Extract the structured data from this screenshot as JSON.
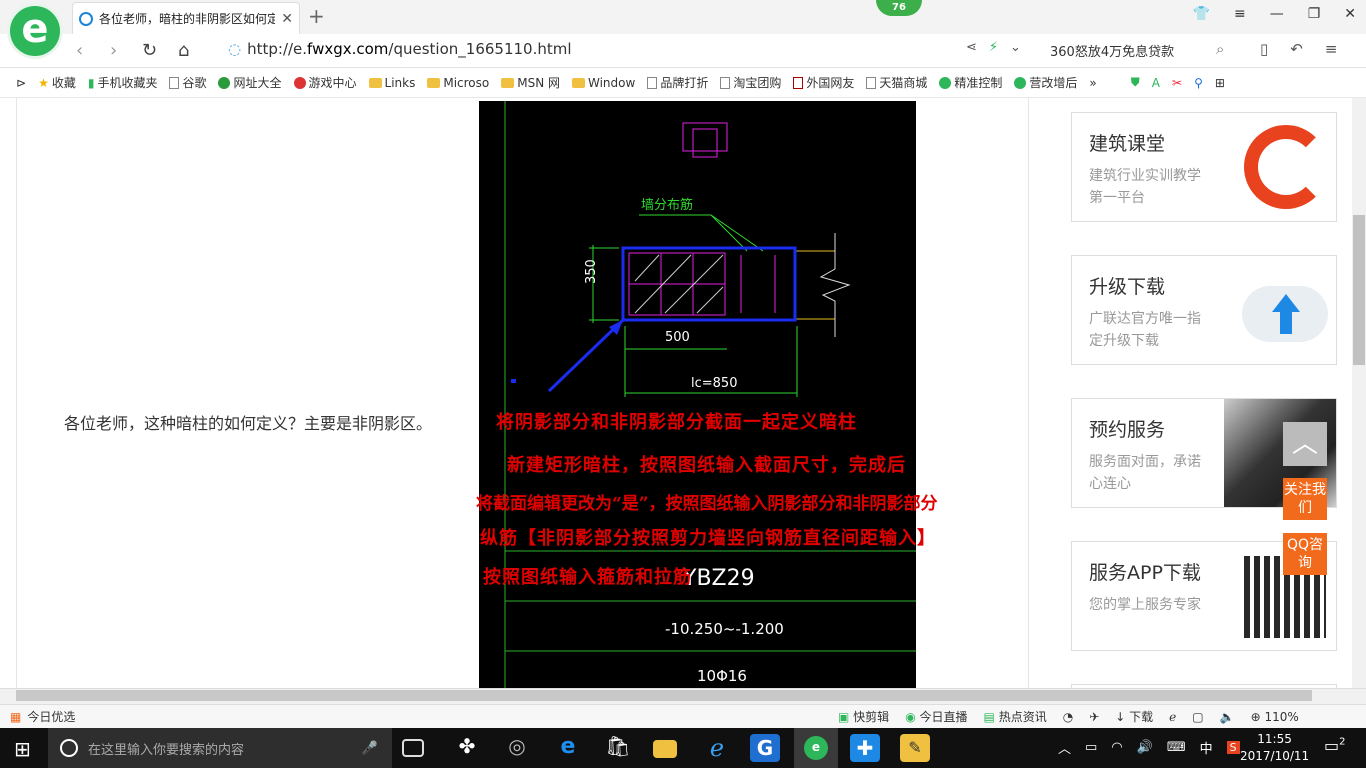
{
  "browser": {
    "tab_title": "各位老师，暗柱的非阴影区如何定",
    "badge": "76",
    "url_prefix": "http://e.",
    "url_domain": "fwxgx.com",
    "url_path": "/question_1665110.html",
    "ad_text": "360怒放4万免息贷款"
  },
  "bookmarks": [
    {
      "label": "收藏",
      "icon": "star-icon"
    },
    {
      "label": "手机收藏夹",
      "icon": "phone-icon"
    },
    {
      "label": "谷歌",
      "icon": "page-icon"
    },
    {
      "label": "网址大全",
      "icon": "globe-icon"
    },
    {
      "label": "游戏中心",
      "icon": "game-icon"
    },
    {
      "label": "Links",
      "icon": "folder-icon"
    },
    {
      "label": "Microso",
      "icon": "folder-icon"
    },
    {
      "label": "MSN 网",
      "icon": "folder-icon"
    },
    {
      "label": "Window",
      "icon": "folder-icon"
    },
    {
      "label": "品牌打折",
      "icon": "page-icon"
    },
    {
      "label": "淘宝团购",
      "icon": "page-icon"
    },
    {
      "label": "外国网友",
      "icon": "page-icon"
    },
    {
      "label": "天猫商城",
      "icon": "page-icon"
    },
    {
      "label": "精准控制",
      "icon": "chat-icon"
    },
    {
      "label": "营改增后",
      "icon": "chat-icon"
    }
  ],
  "question": "各位老师，这种暗柱的如何定义？主要是非阴影区。",
  "cad": {
    "label_wall": "墙分布筋",
    "dim_350": "350",
    "dim_500": "500",
    "dim_lc": "lc=850",
    "table_name": "YBZ29",
    "table_elev": "-10.250~-1.200",
    "table_rebar": "10Φ16"
  },
  "answer": [
    "将阴影部分和非阴影部分截面一起定义暗柱",
    "新建矩形暗柱，按照图纸输入截面尺寸，完成后",
    "将截面编辑更改为“是”，按照图纸输入阴影部分和非阴影部分",
    "纵筋【非阴影部分按照剪力墙竖向钢筋直径间距输入】",
    "按照图纸输入箍筋和拉筋"
  ],
  "sidebar": [
    {
      "title": "建筑课堂",
      "desc": "建筑行业实训教学第一平台"
    },
    {
      "title": "升级下载",
      "desc": "广联达官方唯一指定升级下载"
    },
    {
      "title": "预约服务",
      "desc": "服务面对面，承诺心连心"
    },
    {
      "title": "服务APP下载",
      "desc": "您的掌上服务专家"
    }
  ],
  "float": {
    "follow": "关注我们",
    "qq": "QQ咨询"
  },
  "status": {
    "left": "今日优选",
    "items": [
      "快剪辑",
      "今日直播",
      "热点资讯",
      "下载"
    ],
    "zoom": "110%"
  },
  "taskbar": {
    "search_placeholder": "在这里输入你要搜索的内容",
    "ime": "中",
    "time": "11:55",
    "date": "2017/10/11",
    "notifications": "2"
  }
}
